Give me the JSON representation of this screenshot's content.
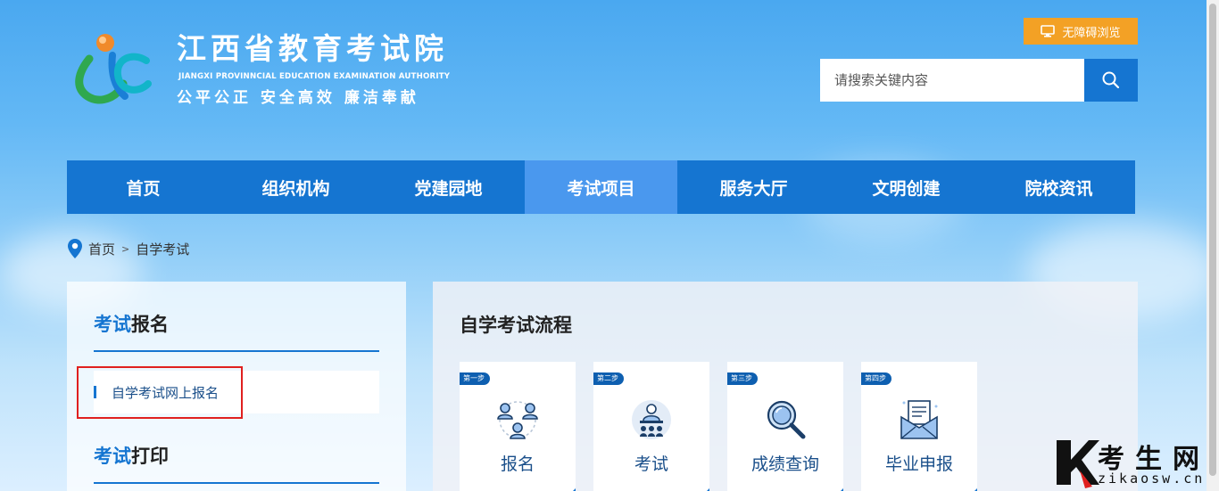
{
  "header": {
    "title": "江西省教育考试院",
    "title_en": "JIANGXI PROVINNCIAL EDUCATION EXAMINATION AUTHORITY",
    "slogan": "公平公正  安全高效  廉洁奉献",
    "accessibility_label": "无障碍浏览",
    "search_placeholder": "请搜索关键内容"
  },
  "nav": {
    "items": [
      {
        "label": "首页"
      },
      {
        "label": "组织机构"
      },
      {
        "label": "党建园地"
      },
      {
        "label": "考试项目"
      },
      {
        "label": "服务大厅"
      },
      {
        "label": "文明创建"
      },
      {
        "label": "院校资讯"
      }
    ],
    "active_index": 3
  },
  "breadcrumb": {
    "home": "首页",
    "separator": ">",
    "current": "自学考试"
  },
  "sidebar": {
    "section1_hl": "考试",
    "section1_rest": "报名",
    "link1": "自学考试网上报名",
    "section2_hl": "考试",
    "section2_rest": "打印"
  },
  "main": {
    "title": "自学考试流程",
    "steps": [
      {
        "badge": "第一步",
        "label": "报名",
        "icon": "people-icon"
      },
      {
        "badge": "第二步",
        "label": "考试",
        "icon": "exam-icon"
      },
      {
        "badge": "第三步",
        "label": "成绩查询",
        "icon": "magnifier-icon"
      },
      {
        "badge": "第四步",
        "label": "毕业申报",
        "icon": "envelope-icon"
      }
    ]
  },
  "watermark": {
    "text": "考生网",
    "sub": "zikaosw.cn"
  },
  "colors": {
    "primary": "#1575d1",
    "nav_active": "#4a98ee",
    "accent_orange": "#f3a125",
    "highlight_red": "#e0201f"
  }
}
